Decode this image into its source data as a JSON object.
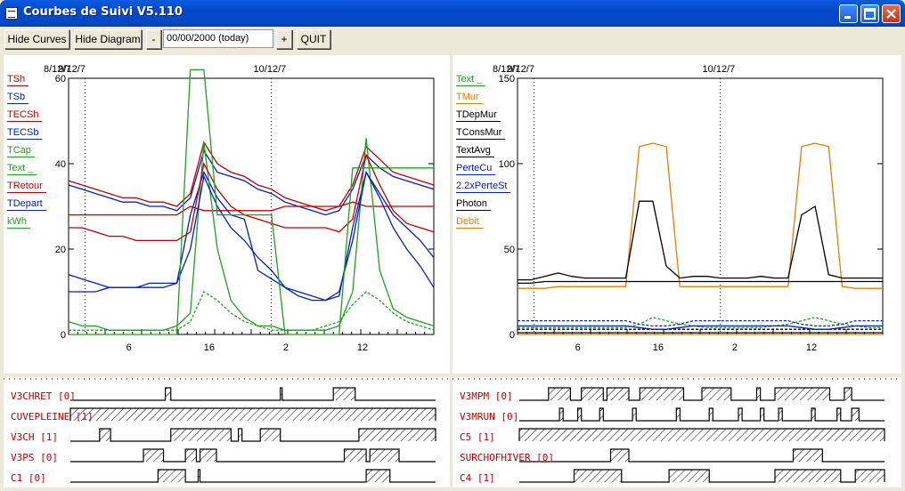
{
  "window": {
    "title": "Courbes de Suivi V5.110"
  },
  "toolbar": {
    "hide_curves_label": "Hide Curves",
    "hide_diagram_label": "Hide Diagram",
    "minus_label": "-",
    "date_value": "00/00/2000 (today)",
    "plus_label": "+",
    "quit_label": "QUIT"
  },
  "left_chart": {
    "date_labels": [
      "8/12/7",
      "9/12/7",
      "10/12/7"
    ],
    "y_ticks": [
      "60",
      "40",
      "20",
      "0"
    ],
    "x_ticks": [
      "6",
      "16",
      "2",
      "12"
    ],
    "legend": [
      {
        "name": "TSh",
        "color": "#c00000"
      },
      {
        "name": "TSb",
        "color": "#0020c0"
      },
      {
        "name": "TECSh",
        "color": "#c00000"
      },
      {
        "name": "TECSb",
        "color": "#0020c0"
      },
      {
        "name": "TCap",
        "color": "#20a020"
      },
      {
        "name": "Text _",
        "color": "#20a020"
      },
      {
        "name": "TRetour",
        "color": "#c00000"
      },
      {
        "name": "TDepart",
        "color": "#0020c0"
      },
      {
        "name": "kWh",
        "color": "#20a020"
      }
    ]
  },
  "right_chart": {
    "date_labels": [
      "8/12/7",
      "9/12/7",
      "10/12/7"
    ],
    "y_ticks": [
      "150",
      "100",
      "50",
      "0"
    ],
    "x_ticks": [
      "6",
      "16",
      "2",
      "12"
    ],
    "legend": [
      {
        "name": "Text _",
        "color": "#20a020"
      },
      {
        "name": "TMur",
        "color": "#e08000"
      },
      {
        "name": "TDepMur",
        "color": "#000000"
      },
      {
        "name": "TConsMur",
        "color": "#000000"
      },
      {
        "name": "TextAvg",
        "color": "#000000"
      },
      {
        "name": "PerteCu",
        "color": "#0020c0"
      },
      {
        "name": "2.2xPerteSt",
        "color": "#0020c0"
      },
      {
        "name": "Photon",
        "color": "#000000"
      },
      {
        "name": "Debit",
        "color": "#e08000"
      }
    ]
  },
  "left_signals": [
    "V3CHRET [0]",
    "CUVEPLEINE [1]",
    "V3CH [1]",
    "V3PS [0]",
    "C1 [0]"
  ],
  "right_signals": [
    "V3MPM [0]",
    "V3MRUN [0]",
    "C5 [1]",
    "SURCHOFHIVER [0]",
    "C4 [1]"
  ],
  "chart_data": [
    {
      "type": "line",
      "title": "",
      "x_tick_labels": [
        "6",
        "16",
        "2",
        "12"
      ],
      "x_date_labels": [
        "8/12/7",
        "9/12/7",
        "10/12/7"
      ],
      "ylim": [
        0,
        60
      ],
      "y_ticks": [
        0,
        20,
        40,
        60
      ],
      "grid": "vertical dotted",
      "legend": "left",
      "series": [
        {
          "name": "TSh",
          "color": "#c00000",
          "values": [
            36,
            35,
            34,
            33,
            32,
            32,
            31,
            31,
            30,
            33,
            45,
            40,
            38,
            37,
            35,
            34,
            32,
            31,
            30,
            29,
            30,
            35,
            44,
            41,
            38,
            37,
            36,
            35
          ]
        },
        {
          "name": "TSb",
          "color": "#0020c0",
          "values": [
            35,
            34,
            33,
            32,
            31,
            31,
            30,
            30,
            29,
            32,
            43,
            38,
            37,
            36,
            34,
            33,
            31,
            30,
            29,
            28,
            29,
            34,
            42,
            39,
            37,
            36,
            35,
            34
          ]
        },
        {
          "name": "TECSh",
          "color": "#c00000",
          "values": [
            28,
            28,
            28,
            28,
            28,
            28,
            28,
            28,
            28,
            30,
            29,
            29,
            29,
            29,
            29,
            29,
            30,
            30,
            30,
            30,
            30,
            31,
            30,
            30,
            30,
            30,
            30,
            30
          ]
        },
        {
          "name": "TECSb",
          "color": "#0020c0",
          "values": [
            10,
            10,
            10,
            11,
            11,
            11,
            12,
            12,
            12,
            28,
            38,
            32,
            28,
            27,
            15,
            13,
            11,
            10,
            9,
            8,
            9,
            25,
            38,
            33,
            28,
            25,
            22,
            18
          ]
        },
        {
          "name": "TCap",
          "color": "#20a020",
          "values": [
            3,
            2,
            2,
            1,
            1,
            1,
            1,
            1,
            2,
            5,
            45,
            20,
            8,
            4,
            2,
            2,
            1,
            1,
            1,
            1,
            2,
            10,
            46,
            15,
            6,
            4,
            3,
            2
          ]
        },
        {
          "name": "Text _",
          "color": "#20a020",
          "values": [
            1,
            1,
            1,
            1,
            1,
            1,
            1,
            1,
            1,
            3,
            10,
            8,
            5,
            3,
            2,
            1,
            1,
            1,
            1,
            2,
            3,
            7,
            10,
            8,
            5,
            3,
            2,
            1
          ]
        },
        {
          "name": "TRetour",
          "color": "#c00000",
          "values": [
            25,
            25,
            24,
            23,
            23,
            22,
            22,
            22,
            22,
            24,
            40,
            34,
            30,
            28,
            27,
            26,
            25,
            25,
            25,
            25,
            24,
            27,
            42,
            35,
            29,
            26,
            25,
            24
          ]
        },
        {
          "name": "TDepart",
          "color": "#0020c0",
          "values": [
            14,
            13,
            12,
            11,
            11,
            11,
            11,
            11,
            12,
            20,
            37,
            30,
            25,
            22,
            18,
            15,
            11,
            9,
            8,
            8,
            10,
            22,
            38,
            32,
            25,
            20,
            16,
            11
          ]
        },
        {
          "name": "kWh",
          "color": "#20a020",
          "values": [
            0,
            0,
            0,
            0,
            0,
            0,
            0,
            0,
            0,
            62,
            62,
            28,
            28,
            28,
            28,
            28,
            0,
            0,
            0,
            0,
            0,
            39,
            39,
            39,
            39,
            39,
            39,
            39
          ]
        }
      ]
    },
    {
      "type": "line",
      "title": "",
      "x_tick_labels": [
        "6",
        "16",
        "2",
        "12"
      ],
      "x_date_labels": [
        "8/12/7",
        "9/12/7",
        "10/12/7"
      ],
      "ylim": [
        0,
        150
      ],
      "y_ticks": [
        0,
        50,
        100,
        150
      ],
      "grid": "vertical dotted",
      "legend": "left",
      "series": [
        {
          "name": "Text _",
          "color": "#20a020",
          "values": [
            4,
            4,
            4,
            4,
            4,
            4,
            4,
            4,
            4,
            6,
            10,
            8,
            6,
            5,
            4,
            4,
            4,
            4,
            4,
            5,
            6,
            8,
            10,
            8,
            6,
            5,
            4,
            4
          ]
        },
        {
          "name": "TMur",
          "color": "#e08000",
          "values": [
            27,
            27,
            27,
            28,
            28,
            28,
            28,
            28,
            28,
            110,
            112,
            110,
            28,
            28,
            28,
            28,
            28,
            28,
            28,
            28,
            28,
            110,
            112,
            110,
            28,
            27,
            27,
            27
          ]
        },
        {
          "name": "TDepMur",
          "color": "#000000",
          "values": [
            32,
            32,
            34,
            36,
            34,
            33,
            33,
            33,
            33,
            78,
            78,
            40,
            33,
            34,
            34,
            33,
            33,
            33,
            34,
            33,
            33,
            70,
            75,
            35,
            33,
            33,
            33,
            33
          ]
        },
        {
          "name": "TConsMur",
          "color": "#000000",
          "values": [
            30,
            30,
            31,
            31,
            31,
            31,
            31,
            31,
            31,
            31,
            31,
            31,
            31,
            31,
            31,
            31,
            31,
            31,
            31,
            31,
            31,
            31,
            31,
            31,
            31,
            31,
            31,
            31
          ]
        },
        {
          "name": "TextAvg",
          "color": "#000000",
          "values": [
            3,
            3,
            3,
            3,
            3,
            3,
            3,
            3,
            3,
            3,
            3,
            3,
            3,
            3,
            3,
            3,
            3,
            3,
            3,
            3,
            3,
            3,
            3,
            3,
            3,
            3,
            3,
            3
          ]
        },
        {
          "name": "PerteCu",
          "color": "#0020c0",
          "values": [
            5,
            5,
            5,
            5,
            5,
            5,
            5,
            5,
            5,
            4,
            3,
            3,
            4,
            5,
            5,
            5,
            5,
            5,
            5,
            5,
            5,
            4,
            3,
            3,
            4,
            5,
            5,
            5
          ]
        },
        {
          "name": "2.2xPerteSt",
          "color": "#0020c0",
          "values": [
            8,
            8,
            8,
            8,
            8,
            8,
            8,
            8,
            8,
            6,
            5,
            5,
            6,
            8,
            8,
            8,
            8,
            8,
            8,
            8,
            8,
            6,
            5,
            5,
            6,
            8,
            8,
            8
          ]
        },
        {
          "name": "Photon",
          "color": "#000000",
          "values": [
            1,
            1,
            1,
            1,
            1,
            1,
            1,
            1,
            1,
            1,
            1,
            1,
            1,
            1,
            1,
            1,
            1,
            1,
            1,
            1,
            1,
            1,
            1,
            1,
            1,
            1,
            1,
            1
          ]
        },
        {
          "name": "Debit",
          "color": "#e08000",
          "values": [
            0,
            0,
            0,
            0,
            0,
            0,
            0,
            0,
            0,
            0,
            0,
            0,
            0,
            0,
            0,
            0,
            0,
            0,
            0,
            0,
            0,
            0,
            0,
            0,
            0,
            0,
            0,
            0
          ]
        }
      ]
    }
  ],
  "signal_data": {
    "left": [
      [
        [
          0.26,
          0.275
        ],
        [
          0.575,
          0.58
        ],
        [
          0.72,
          0.78
        ]
      ],
      [
        [
          0,
          1
        ]
      ],
      [
        [
          0.08,
          0.11
        ],
        [
          0.275,
          0.44
        ],
        [
          0.46,
          0.47
        ],
        [
          0.52,
          0.575
        ],
        [
          0.79,
          1
        ]
      ],
      [
        [
          0.2,
          0.255
        ],
        [
          0.315,
          0.345
        ],
        [
          0.355,
          0.4
        ],
        [
          0.75,
          0.81
        ],
        [
          0.82,
          0.9
        ]
      ],
      [
        [
          0.24,
          0.315
        ],
        [
          0.35,
          0.355
        ],
        [
          0.81,
          0.875
        ]
      ]
    ],
    "right": [
      [
        [
          0.08,
          0.14
        ],
        [
          0.17,
          0.23
        ],
        [
          0.24,
          0.3
        ],
        [
          0.33,
          0.45
        ],
        [
          0.5,
          0.58
        ],
        [
          0.65,
          0.66
        ],
        [
          0.7,
          0.85
        ],
        [
          0.89,
          0.91
        ]
      ],
      [
        [
          0.11,
          0.12
        ],
        [
          0.16,
          0.17
        ],
        [
          0.22,
          0.23
        ],
        [
          0.31,
          0.32
        ],
        [
          0.43,
          0.44
        ],
        [
          0.52,
          0.53
        ],
        [
          0.6,
          0.61
        ],
        [
          0.66,
          0.67
        ],
        [
          0.71,
          0.72
        ],
        [
          0.8,
          0.81
        ],
        [
          0.87,
          0.88
        ],
        [
          0.91,
          0.93
        ]
      ],
      [
        [
          0,
          1
        ]
      ],
      [
        [
          0.25,
          0.3
        ],
        [
          0.75,
          0.83
        ]
      ],
      [
        [
          0.15,
          0.28
        ],
        [
          0.41,
          0.52
        ],
        [
          0.7,
          0.88
        ],
        [
          0.92,
          1
        ]
      ]
    ]
  }
}
